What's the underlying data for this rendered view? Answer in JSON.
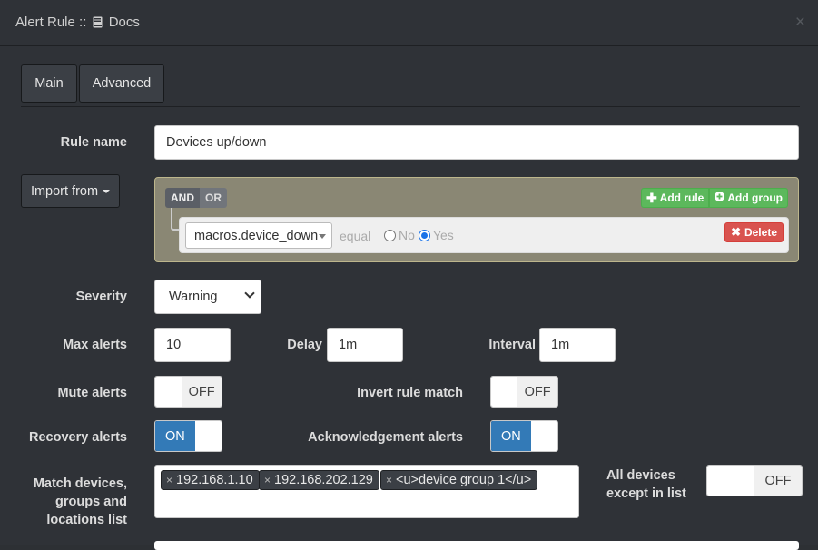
{
  "header": {
    "title_prefix": "Alert Rule ::",
    "title_doc": "Docs",
    "close_glyph": "×"
  },
  "tabs": [
    {
      "label": "Main",
      "active": true
    },
    {
      "label": "Advanced",
      "active": false
    }
  ],
  "form": {
    "rule_name_label": "Rule name",
    "rule_name_value": "Devices up/down",
    "import_label": "Import from",
    "builder": {
      "and_label": "AND",
      "or_label": "OR",
      "add_rule_label": "Add rule",
      "add_group_label": "Add group",
      "field_value": "macros.device_down",
      "operator": "equal",
      "opt_no": "No",
      "opt_yes": "Yes",
      "selected": "Yes",
      "delete_label": "Delete"
    },
    "severity_label": "Severity",
    "severity_value": "Warning",
    "max_alerts_label": "Max alerts",
    "max_alerts_value": "10",
    "delay_label": "Delay",
    "delay_value": "1m",
    "interval_label": "Interval",
    "interval_value": "1m",
    "mute_label": "Mute alerts",
    "mute_state": "OFF",
    "invert_label": "Invert rule match",
    "invert_state": "OFF",
    "recovery_label": "Recovery alerts",
    "recovery_state": "ON",
    "ack_label": "Acknowledgement alerts",
    "ack_state": "ON",
    "match_label_1": "Match devices,",
    "match_label_2": "groups and",
    "match_label_3": "locations list",
    "tags": [
      "192.168.1.10",
      "192.168.202.129",
      "<u>device group 1</u>"
    ],
    "all_devices_label_1": "All devices",
    "all_devices_label_2": "except in list",
    "all_devices_state": "OFF"
  },
  "colors": {
    "accent_blue": "#337ab7",
    "success_green": "#5cb85c",
    "danger_red": "#d9534f",
    "builder_bg": "#8a8774"
  },
  "icons": {
    "title": "book-icon",
    "add_rule": "plus-icon",
    "add_group": "plus-circle-icon",
    "delete": "times-icon"
  }
}
